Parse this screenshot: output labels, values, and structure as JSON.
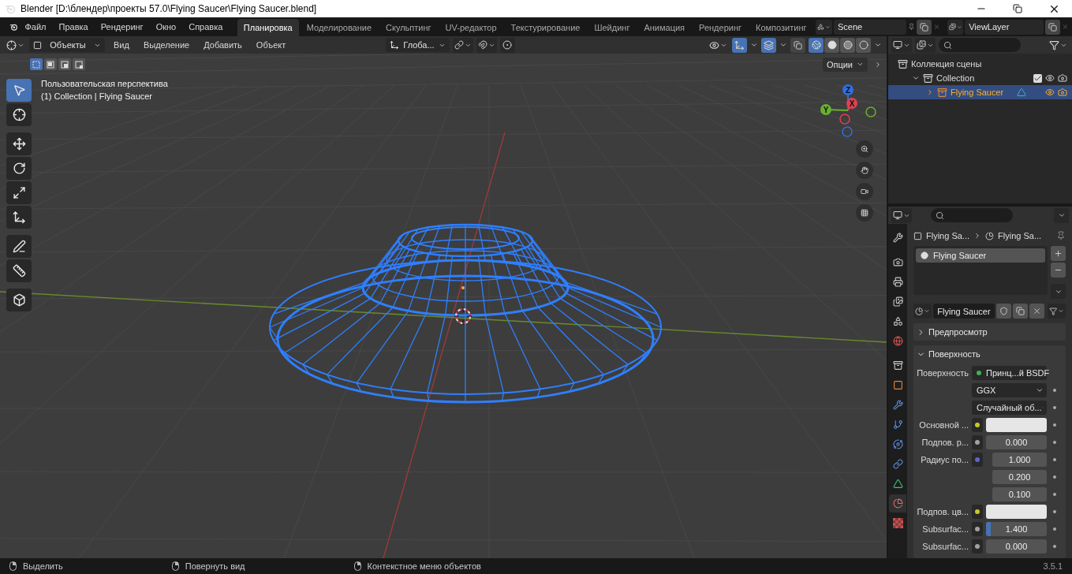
{
  "title_bar": {
    "title": "Blender [D:\\блендер\\проекты 57.0\\Flying Saucer\\Flying Saucer.blend]"
  },
  "top_bar": {
    "menus": [
      "Файл",
      "Правка",
      "Рендеринг",
      "Окно",
      "Справка"
    ],
    "workspaces": [
      {
        "label": "Планировка",
        "selected": true
      },
      {
        "label": "Моделирование",
        "selected": false
      },
      {
        "label": "Скульптинг",
        "selected": false
      },
      {
        "label": "UV-редактор",
        "selected": false
      },
      {
        "label": "Текстурирование",
        "selected": false
      },
      {
        "label": "Шейдинг",
        "selected": false
      },
      {
        "label": "Анимация",
        "selected": false
      },
      {
        "label": "Рендеринг",
        "selected": false
      },
      {
        "label": "Композитинг",
        "selected": false
      }
    ],
    "scene": "Scene",
    "view_layer": "ViewLayer"
  },
  "viewport": {
    "mode": "Объекты",
    "menus": [
      "Вид",
      "Выделение",
      "Добавить",
      "Объект"
    ],
    "orientation": "Глоба...",
    "select_modes": [
      {
        "selected": true
      },
      {
        "selected": false
      },
      {
        "selected": false
      },
      {
        "selected": false
      }
    ],
    "options": "Опции",
    "gizmos_on": true,
    "overlays_on": true,
    "shading_modes": [
      {
        "selected": true
      },
      {
        "selected": false
      },
      {
        "selected": false
      },
      {
        "selected": false
      }
    ],
    "view_name": "Пользовательская перспектива",
    "collection_info": "(1) Collection | Flying Saucer",
    "tools": [
      {
        "kind": "select",
        "selected": true
      },
      {
        "kind": "cursor",
        "selected": false
      },
      {
        "kind": "move",
        "selected": false
      },
      {
        "kind": "rotate",
        "selected": false
      },
      {
        "kind": "scale",
        "selected": false
      },
      {
        "kind": "transform",
        "selected": false
      },
      {
        "kind": "annotate",
        "selected": false
      },
      {
        "kind": "measure",
        "selected": false
      },
      {
        "kind": "add_cube",
        "selected": false
      }
    ],
    "gizmo": {
      "x": "X",
      "y": "Y",
      "z": "Z"
    }
  },
  "outliner": {
    "items": [
      {
        "label": "Коллекция сцены",
        "selected": false,
        "children": [
          {
            "label": "Collection",
            "selected": false,
            "expanded": true,
            "checked": true,
            "children": [
              {
                "label": "Flying Saucer",
                "selected": true,
                "expanded": false
              }
            ]
          }
        ]
      }
    ]
  },
  "properties": {
    "tabs": [
      {
        "kind": "tool",
        "selected": false
      },
      {
        "kind": "render",
        "selected": false
      },
      {
        "kind": "output",
        "selected": false
      },
      {
        "kind": "view_layer",
        "selected": false
      },
      {
        "kind": "scene",
        "selected": false
      },
      {
        "kind": "world",
        "selected": false
      },
      {
        "kind": "collection",
        "selected": false
      },
      {
        "kind": "object",
        "selected": false
      },
      {
        "kind": "modifiers",
        "selected": false
      },
      {
        "kind": "particles",
        "selected": false
      },
      {
        "kind": "physics",
        "selected": false
      },
      {
        "kind": "constraints",
        "selected": false
      },
      {
        "kind": "data",
        "selected": false
      },
      {
        "kind": "material",
        "selected": true
      },
      {
        "kind": "texture",
        "selected": false
      }
    ],
    "breadcrumb": [
      "Flying Sa...",
      "Flying Sa..."
    ],
    "material_slots": [
      {
        "label": "Flying Saucer",
        "selected": true
      }
    ],
    "material_name": "Flying Saucer",
    "panels": [
      {
        "label": "Предпросмотр",
        "expanded": false
      },
      {
        "label": "Поверхность",
        "expanded": true
      }
    ],
    "surface_rows": [
      {
        "kind": "shader",
        "label": "Поверхность",
        "value": "Принц...й BSDF",
        "color": "#3fb04f"
      },
      {
        "kind": "dropdown",
        "value": "GGX"
      },
      {
        "kind": "dropdown",
        "value": "Случайный об..."
      },
      {
        "kind": "swatch",
        "label": "Основной ...",
        "color": "#c7c729"
      },
      {
        "kind": "number",
        "label": "Подпов. р...",
        "color": "#a1a1a1",
        "value": "0.000"
      },
      {
        "kind": "vector",
        "label": "Радиус по...",
        "color": "#6363c7",
        "values": [
          "1.000",
          "0.200",
          "0.100"
        ]
      },
      {
        "kind": "swatch",
        "label": "Подпов. цв...",
        "color": "#c7c729"
      },
      {
        "kind": "slider",
        "label": "Subsurfac...",
        "color": "#a1a1a1",
        "value": "1.400",
        "level": 0.08
      },
      {
        "kind": "number",
        "label": "Subsurfac...",
        "color": "#a1a1a1",
        "value": "0.000"
      }
    ]
  },
  "status_bar": {
    "hints": [
      "Выделить",
      "Повернуть вид",
      "Контекстное меню объектов"
    ],
    "version": "3.5.1"
  }
}
